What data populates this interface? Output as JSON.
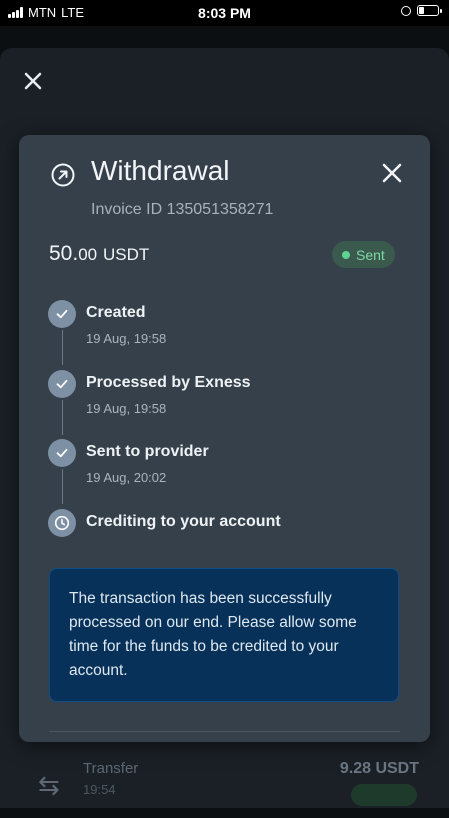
{
  "status_bar": {
    "carrier": "MTN",
    "network": "LTE",
    "time": "8:03 PM"
  },
  "background": {
    "transfer_title": "Transfer",
    "transfer_time": "19:54",
    "transfer_amount": "9.28 USDT"
  },
  "modal": {
    "title": "Withdrawal",
    "invoice": "Invoice ID 135051358271",
    "amount_int": "50.",
    "amount_dec": "00",
    "currency": "USDT",
    "status": "Sent",
    "steps": [
      {
        "label": "Created",
        "time": "19 Aug, 19:58",
        "icon": "check-icon"
      },
      {
        "label": "Processed by Exness",
        "time": "19 Aug, 19:58",
        "icon": "check-icon"
      },
      {
        "label": "Sent to provider",
        "time": "19 Aug, 20:02",
        "icon": "check-icon"
      },
      {
        "label": "Crediting to your account",
        "icon": "clock-icon"
      }
    ],
    "notice": "The transaction has been successfully processed on our end. Please allow some time for the funds to be credited to your account."
  },
  "colors": {
    "card": "#36404a",
    "accent_green": "#5fd391",
    "notice_bg": "#073158",
    "step_circle": "#7e90a3"
  }
}
